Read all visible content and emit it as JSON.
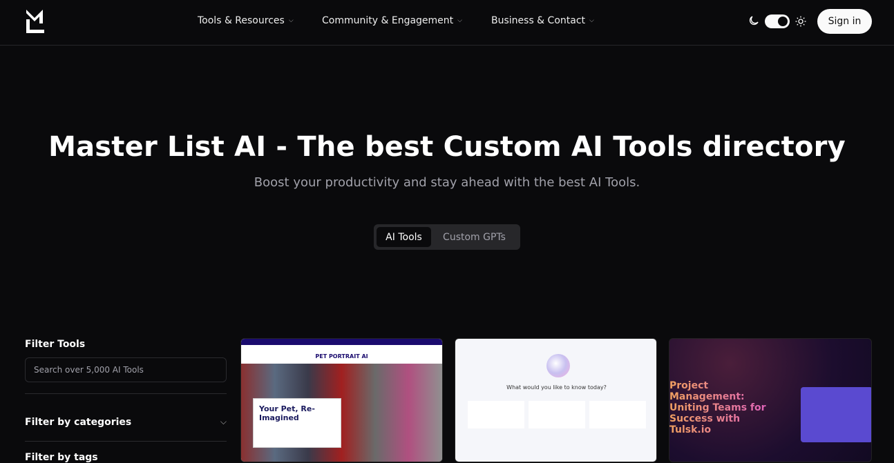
{
  "header": {
    "logo": "ML",
    "nav": [
      {
        "label": "Tools & Resources"
      },
      {
        "label": "Community & Engagement"
      },
      {
        "label": "Business & Contact"
      }
    ],
    "signin": "Sign in",
    "theme": "dark"
  },
  "hero": {
    "title": "Master List AI - The best Custom AI Tools directory",
    "subtitle": "Boost your productivity and stay ahead with the best AI Tools.",
    "tabs": [
      {
        "label": "AI Tools",
        "active": true
      },
      {
        "label": "Custom GPTs",
        "active": false
      }
    ]
  },
  "sidebar": {
    "filter_title": "Filter Tools",
    "search_placeholder": "Search over 5,000 AI Tools",
    "categories": "Filter by categories",
    "tags": "Filter by tags"
  },
  "cards": [
    {
      "brand": "PET PORTRAIT AI",
      "headline": "Your Pet, Re-Imagined"
    },
    {
      "headline": "What would you like to know today?"
    },
    {
      "headline": "Project Management: Uniting Teams for Success with Tulsk.io"
    }
  ]
}
